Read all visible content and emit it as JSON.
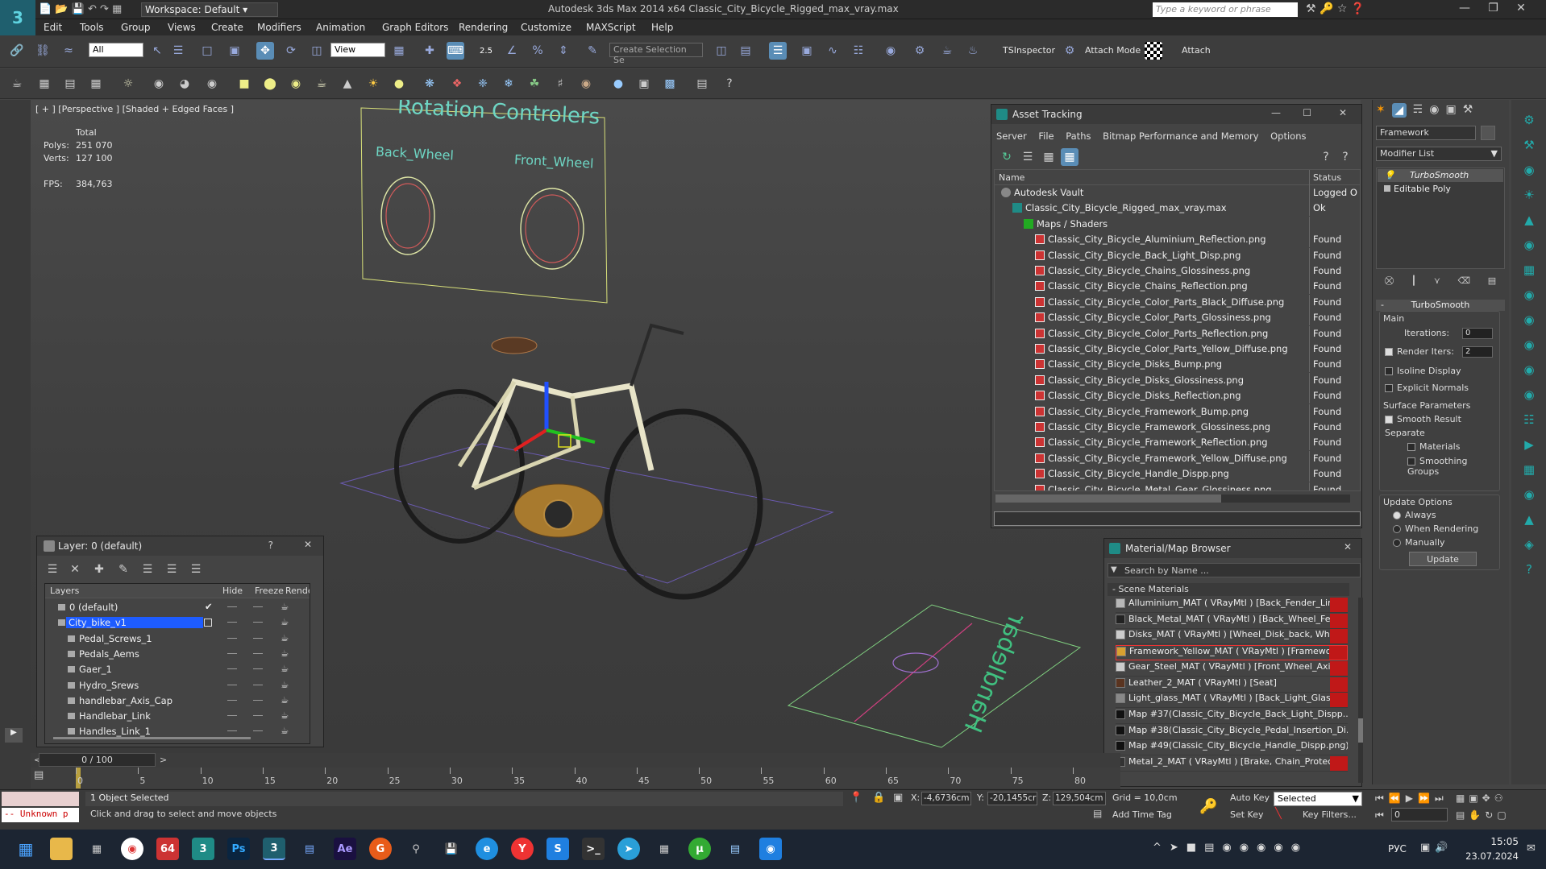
{
  "titlebar": {
    "workspace_label": "Workspace: Default",
    "title": "Autodesk 3ds Max  2014 x64     Classic_City_Bicycle_Rigged_max_vray.max",
    "search_placeholder": "Type a keyword or phrase"
  },
  "menu": [
    "Edit",
    "Tools",
    "Group",
    "Views",
    "Create",
    "Modifiers",
    "Animation",
    "Graph Editors",
    "Rendering",
    "Customize",
    "MAXScript",
    "Help"
  ],
  "toolbar1": {
    "filter_value": "All",
    "refcoord_value": "View",
    "snap_value": "2.5",
    "selection_set_placeholder": "Create Selection Se",
    "tsinspector_label": "TSInspector",
    "attach_mode_label": "Attach Mode",
    "attach_label": "Attach"
  },
  "viewport": {
    "label": "[ + ] [Perspective ] [Shaded + Edged Faces ]",
    "stats": {
      "total_label": "Total",
      "polys_label": "Polys:",
      "polys_value": "251 070",
      "verts_label": "Verts:",
      "verts_value": "127 100",
      "fps_label": "FPS:",
      "fps_value": "384,763"
    },
    "rotation_title": "Rotation Controlers",
    "back_wheel_label": "Back_Wheel",
    "front_wheel_label": "Front_Wheel",
    "handlebar_label": "Handlebar"
  },
  "asset_tracking": {
    "title": "Asset Tracking",
    "menu": [
      "Server",
      "File",
      "Paths",
      "Bitmap Performance and Memory",
      "Options"
    ],
    "col_name": "Name",
    "col_status": "Status",
    "rows": [
      {
        "name": "Autodesk Vault",
        "status": "Logged O",
        "indent": 1
      },
      {
        "name": "Classic_City_Bicycle_Rigged_max_vray.max",
        "status": "Ok",
        "indent": 2
      },
      {
        "name": "Maps / Shaders",
        "status": "",
        "indent": 3
      },
      {
        "name": "Classic_City_Bicycle_Aluminium_Reflection.png",
        "status": "Found",
        "indent": 4
      },
      {
        "name": "Classic_City_Bicycle_Back_Light_Disp.png",
        "status": "Found",
        "indent": 4
      },
      {
        "name": "Classic_City_Bicycle_Chains_Glossiness.png",
        "status": "Found",
        "indent": 4
      },
      {
        "name": "Classic_City_Bicycle_Chains_Reflection.png",
        "status": "Found",
        "indent": 4
      },
      {
        "name": "Classic_City_Bicycle_Color_Parts_Black_Diffuse.png",
        "status": "Found",
        "indent": 4
      },
      {
        "name": "Classic_City_Bicycle_Color_Parts_Glossiness.png",
        "status": "Found",
        "indent": 4
      },
      {
        "name": "Classic_City_Bicycle_Color_Parts_Reflection.png",
        "status": "Found",
        "indent": 4
      },
      {
        "name": "Classic_City_Bicycle_Color_Parts_Yellow_Diffuse.png",
        "status": "Found",
        "indent": 4
      },
      {
        "name": "Classic_City_Bicycle_Disks_Bump.png",
        "status": "Found",
        "indent": 4
      },
      {
        "name": "Classic_City_Bicycle_Disks_Glossiness.png",
        "status": "Found",
        "indent": 4
      },
      {
        "name": "Classic_City_Bicycle_Disks_Reflection.png",
        "status": "Found",
        "indent": 4
      },
      {
        "name": "Classic_City_Bicycle_Framework_Bump.png",
        "status": "Found",
        "indent": 4
      },
      {
        "name": "Classic_City_Bicycle_Framework_Glossiness.png",
        "status": "Found",
        "indent": 4
      },
      {
        "name": "Classic_City_Bicycle_Framework_Reflection.png",
        "status": "Found",
        "indent": 4
      },
      {
        "name": "Classic_City_Bicycle_Framework_Yellow_Diffuse.png",
        "status": "Found",
        "indent": 4
      },
      {
        "name": "Classic_City_Bicycle_Handle_Dispp.png",
        "status": "Found",
        "indent": 4
      },
      {
        "name": "Classic_City_Bicycle_Metal_Gear_Glossiness.png",
        "status": "Found",
        "indent": 4
      }
    ]
  },
  "layer_panel": {
    "title": "Layer: 0 (default)",
    "col_layers": "Layers",
    "col_hide": "Hide",
    "col_freeze": "Freeze",
    "col_render": "Rende",
    "rows": [
      {
        "name": "0 (default)",
        "selected": false,
        "indent": 1
      },
      {
        "name": "City_bike_v1",
        "selected": true,
        "indent": 1
      },
      {
        "name": "Pedal_Screws_1",
        "selected": false,
        "indent": 2
      },
      {
        "name": "Pedals_Aems",
        "selected": false,
        "indent": 2
      },
      {
        "name": "Gaer_1",
        "selected": false,
        "indent": 2
      },
      {
        "name": "Hydro_Srews",
        "selected": false,
        "indent": 2
      },
      {
        "name": "handlebar_Axis_Cap",
        "selected": false,
        "indent": 2
      },
      {
        "name": "Handlebar_Link",
        "selected": false,
        "indent": 2
      },
      {
        "name": "Handles_Link_1",
        "selected": false,
        "indent": 2
      }
    ]
  },
  "material_browser": {
    "title": "Material/Map Browser",
    "search_placeholder": "Search by Name ...",
    "section": "- Scene Materials",
    "rows": [
      "Alluminium_MAT ( VRayMtl ) [Back_Fender_Link,...",
      "Black_Metal_MAT ( VRayMtl ) [Back_Wheel_Fen...",
      "Disks_MAT ( VRayMtl ) [Wheel_Disk_back, Whee...",
      "Framework_Yellow_MAT ( VRayMtl ) [Framework]",
      "Gear_Steel_MAT ( VRayMtl ) [Front_Wheel_Axis,...",
      "Leather_2_MAT ( VRayMtl ) [Seat]",
      "Light_glass_MAT ( VRayMtl ) [Back_Light_Glass,...",
      "Map #37(Classic_City_Bicycle_Back_Light_Dispp...",
      "Map #38(Classic_City_Bicycle_Pedal_Insertion_Di...",
      "Map #49(Classic_City_Bicycle_Handle_Dispp.png)...",
      "Metal_2_MAT ( VRayMtl ) [Brake, Chain_Protecto..."
    ]
  },
  "command_panel": {
    "object_name": "Framework",
    "modifier_list": "Modifier List",
    "stack": [
      "TurboSmooth",
      "Editable Poly"
    ],
    "rollout_title": "TurboSmooth",
    "main_label": "Main",
    "iterations_label": "Iterations:",
    "iterations_value": "0",
    "render_iters_label": "Render Iters:",
    "render_iters_value": "2",
    "isoline_label": "Isoline Display",
    "explicit_normals_label": "Explicit Normals",
    "surface_params_label": "Surface Parameters",
    "smooth_result_label": "Smooth Result",
    "separate_label": "Separate",
    "materials_label": "Materials",
    "smoothing_groups_label": "Smoothing Groups",
    "update_options_label": "Update Options",
    "always_label": "Always",
    "when_rendering_label": "When Rendering",
    "manually_label": "Manually",
    "update_button": "Update"
  },
  "timeline": {
    "frame_counter": "0 / 100",
    "ticks": [
      "0",
      "5",
      "10",
      "15",
      "20",
      "25",
      "30",
      "35",
      "40",
      "45",
      "50",
      "55",
      "60",
      "65",
      "70",
      "75",
      "80"
    ]
  },
  "statusbar": {
    "maxscript_text": "-- Unknown p",
    "selection_text": "1 Object Selected",
    "prompt_text": "Click and drag to select and move objects",
    "x_label": "X:",
    "x_value": "-4,6736cm",
    "y_label": "Y:",
    "y_value": "-20,1455cr",
    "z_label": "Z:",
    "z_value": "129,504cm",
    "grid_text": "Grid = 10,0cm",
    "add_time_tag": "Add Time Tag",
    "auto_key": "Auto Key",
    "set_key": "Set Key",
    "selected_value": "Selected",
    "key_filters": "Key Filters...",
    "frame_value": "0"
  },
  "taskbar": {
    "lang": "РУС",
    "time": "15:05",
    "date": "23.07.2024"
  }
}
